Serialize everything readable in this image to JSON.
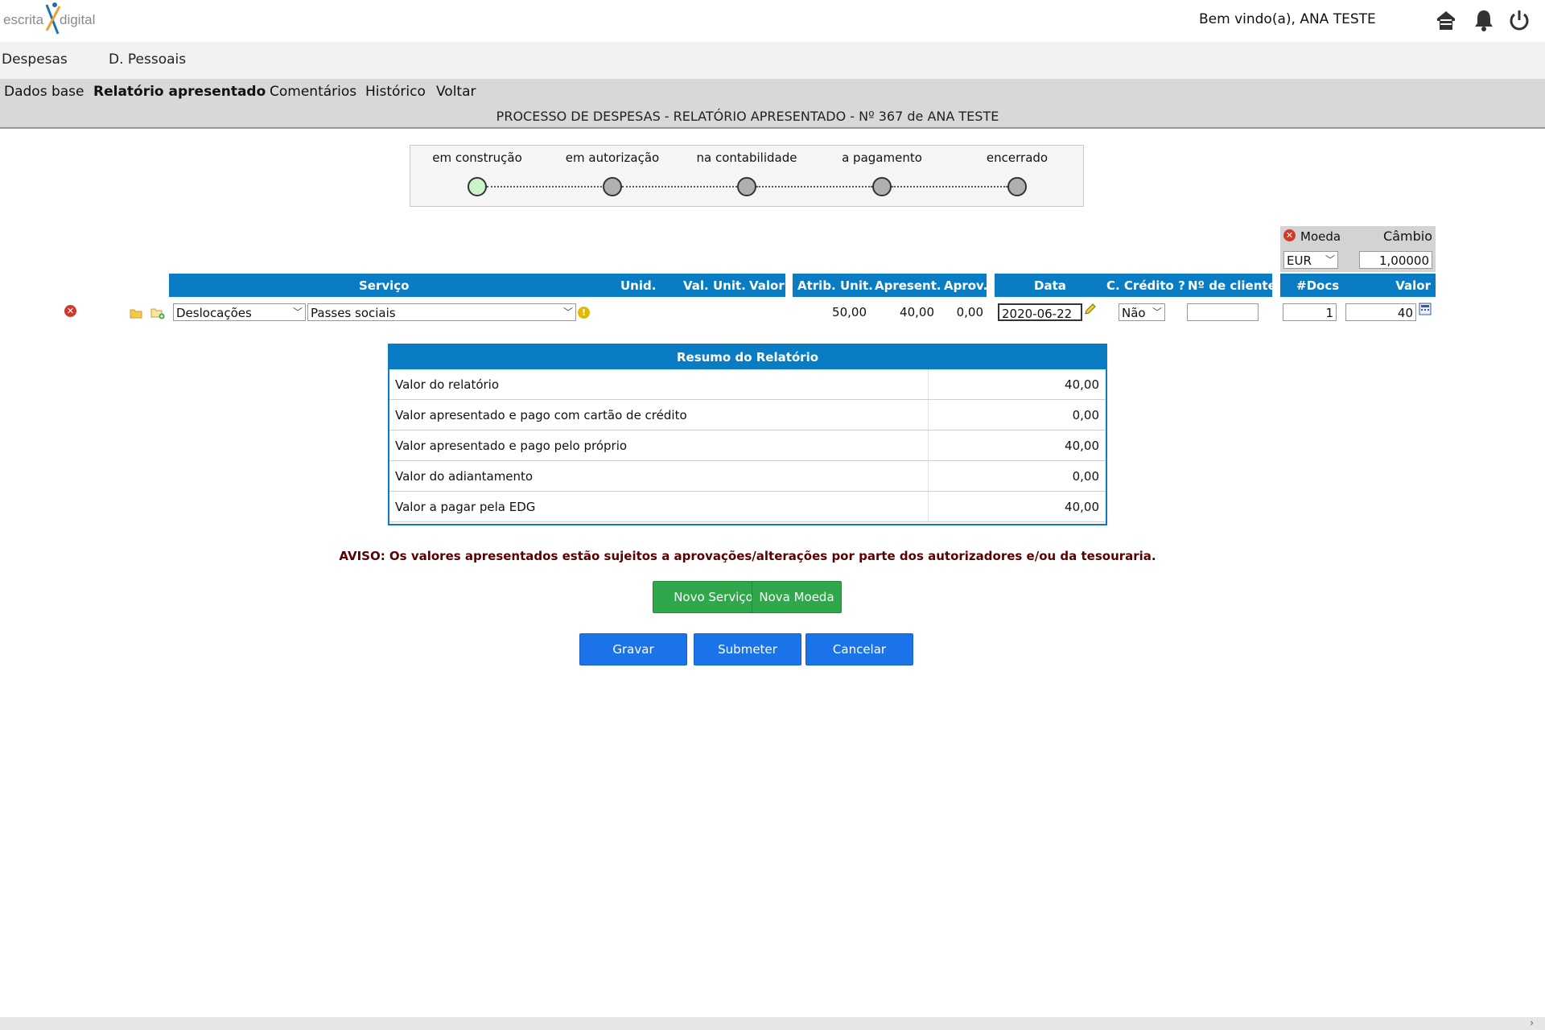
{
  "header": {
    "logo_left": "escrita",
    "logo_right": "digital",
    "welcome": "Bem vindo(a), ANA TESTE",
    "icons": [
      "home-icon",
      "bell-icon",
      "power-icon"
    ]
  },
  "menu": {
    "items": [
      "Despesas",
      "D. Pessoais"
    ]
  },
  "tabs": [
    "Dados base",
    "Relatório apresentado",
    "Comentários",
    "Histórico",
    "Voltar"
  ],
  "active_tab": "Relatório apresentado",
  "page_title": "PROCESSO DE DESPESAS - RELATÓRIO APRESENTADO - Nº 367 de ANA TESTE",
  "stepper": {
    "steps": [
      "em construção",
      "em autorização",
      "na contabilidade",
      "a pagamento",
      "encerrado"
    ],
    "current_index": 0,
    "colors": {
      "current": "#c9f5c9",
      "pending": "#b0b0b0"
    }
  },
  "moeda": {
    "moeda_label": "Moeda",
    "cambio_label": "Câmbio",
    "currency": "EUR",
    "rate": "1,00000"
  },
  "table": {
    "headers": {
      "servico": "Serviço",
      "unid": "Unid.",
      "val_unit": "Val. Unit.",
      "valor": "Valor",
      "atrib_unit": "Atrib. Unit.",
      "apresent": "Apresent.",
      "aprov": "Aprov.",
      "data": "Data",
      "c_credito": "C. Crédito ?",
      "n_cliente": "Nº de cliente",
      "n_docs": "#Docs",
      "valor2": "Valor"
    },
    "row": {
      "categoria": "Deslocações",
      "servico": "Passes sociais",
      "atrib_unit": "50,00",
      "apresent": "40,00",
      "aprov": "0,00",
      "data": "2020-06-22",
      "c_credito": "Não",
      "n_cliente": "",
      "n_docs": "1",
      "valor": "40"
    }
  },
  "summary": {
    "title": "Resumo do Relatório",
    "rows": [
      {
        "label": "Valor do relatório",
        "value": "40,00"
      },
      {
        "label": "Valor apresentado e pago com cartão de crédito",
        "value": "0,00"
      },
      {
        "label": "Valor apresentado e pago pelo próprio",
        "value": "40,00"
      },
      {
        "label": "Valor do adiantamento",
        "value": "0,00"
      },
      {
        "label": "Valor a pagar pela EDG",
        "value": "40,00"
      }
    ]
  },
  "aviso": "AVISO: Os valores apresentados estão sujeitos a aprovações/alterações por parte dos autorizadores e/ou da tesouraria.",
  "buttons": {
    "novo_servico": "Novo Serviço",
    "nova_moeda": "Nova Moeda",
    "gravar": "Gravar",
    "submeter": "Submeter",
    "cancelar": "Cancelar"
  },
  "colors": {
    "header_blue": "#0a7cc4",
    "button_green": "#2ea84a",
    "button_blue": "#1a73e8",
    "aviso_text": "#5a0000"
  }
}
